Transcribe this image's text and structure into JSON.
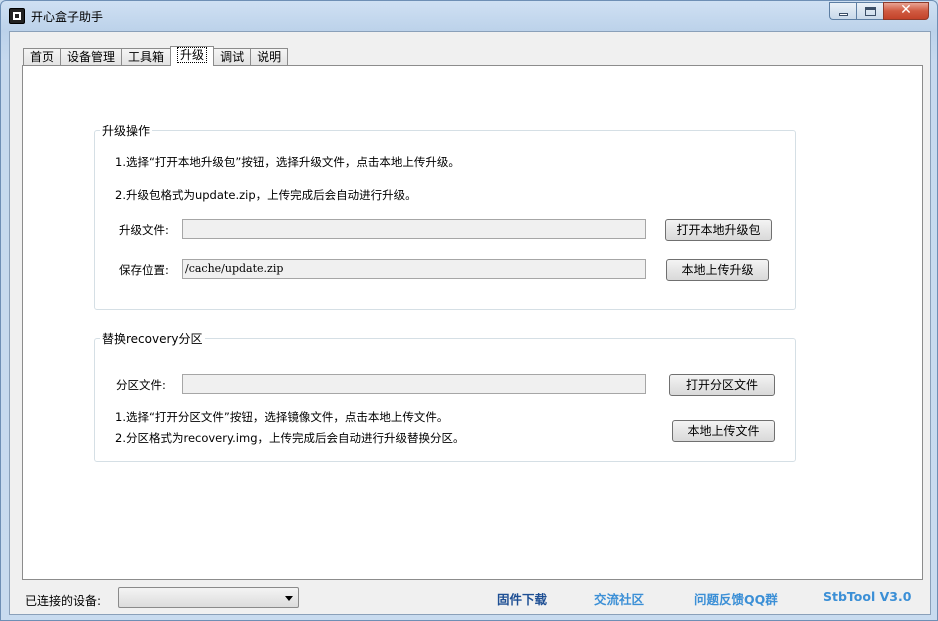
{
  "window": {
    "title": "开心盒子助手",
    "minimize_label": "",
    "maximize_label": "",
    "close_label": "✕"
  },
  "tabs": [
    {
      "label": "首页"
    },
    {
      "label": "设备管理"
    },
    {
      "label": "工具箱"
    },
    {
      "label": "升级"
    },
    {
      "label": "调试"
    },
    {
      "label": "说明"
    }
  ],
  "upgrade_group": {
    "title": "升级操作",
    "instruction_1": "1.选择“打开本地升级包”按钮，选择升级文件，点击本地上传升级。",
    "instruction_2": "2.升级包格式为update.zip，上传完成后会自动进行升级。",
    "file_label": "升级文件:",
    "file_value": "",
    "open_button": "打开本地升级包",
    "save_label": "保存位置:",
    "save_value": "/cache/update.zip",
    "upload_button": "本地上传升级"
  },
  "recovery_group": {
    "title": "替换recovery分区",
    "file_label": "分区文件:",
    "file_value": "",
    "open_button": "打开分区文件",
    "instruction_1": "1.选择“打开分区文件”按钮，选择镜像文件，点击本地上传文件。",
    "instruction_2": "2.分区格式为recovery.img，上传完成后会自动进行升级替换分区。",
    "upload_button": "本地上传文件"
  },
  "status_bar": {
    "device_label": "已连接的设备:",
    "device_value": "",
    "links": {
      "firmware": "固件下载",
      "community": "交流社区",
      "feedback": "问题反馈QQ群",
      "version": "StbTool V3.0"
    }
  },
  "colors": {
    "link_dark": "#1e4f94",
    "link_light": "#3b8fd6"
  }
}
